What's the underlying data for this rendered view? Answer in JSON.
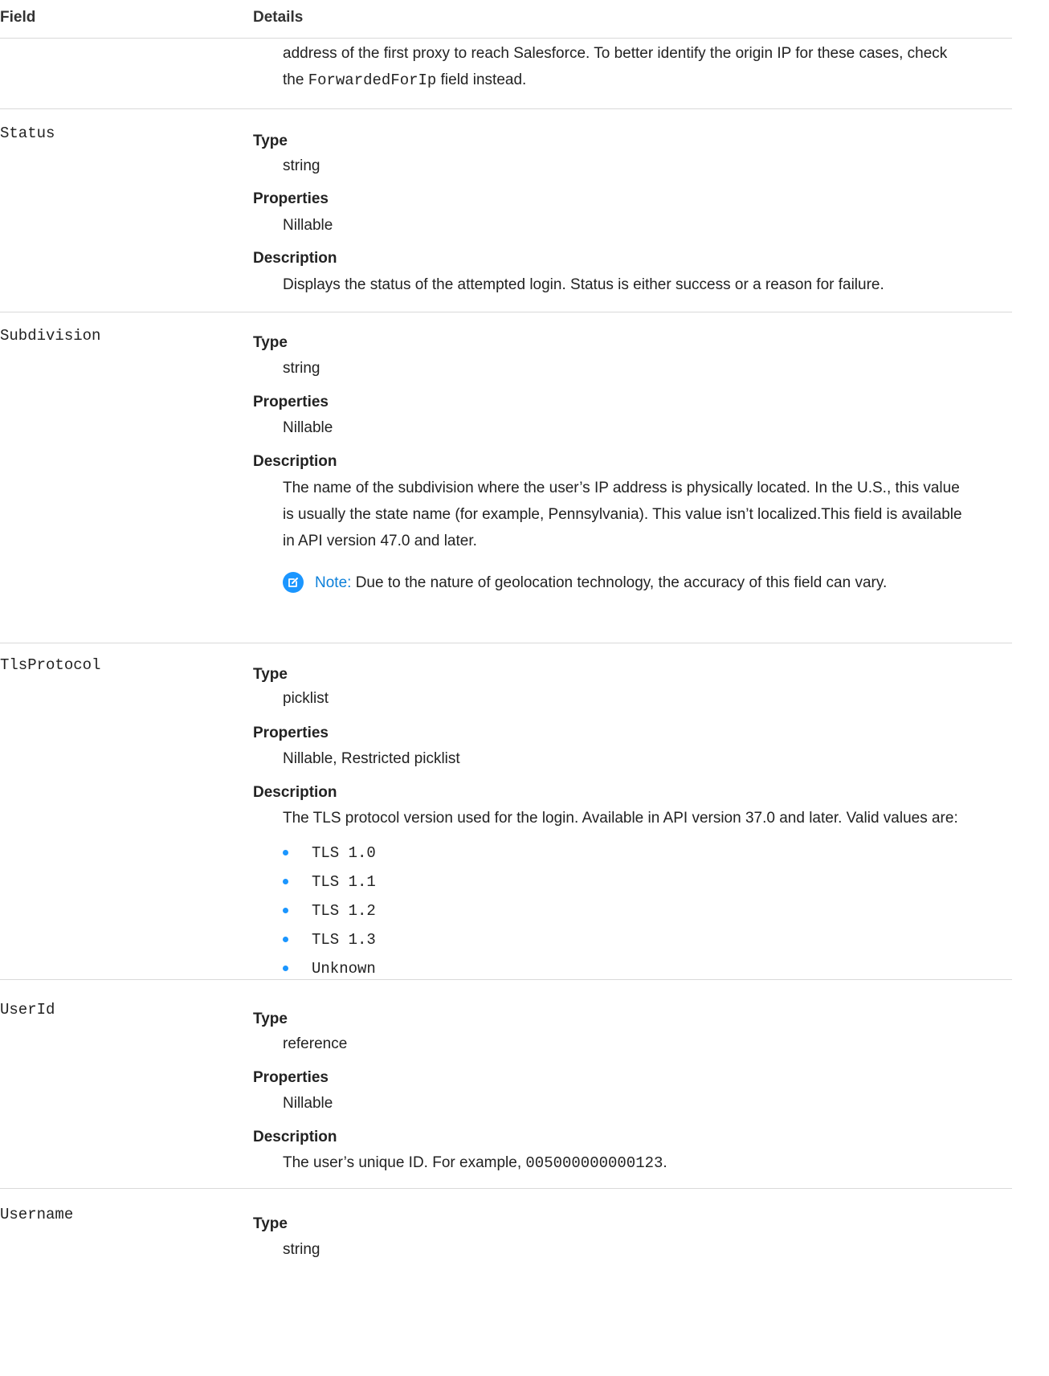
{
  "header": {
    "field": "Field",
    "details": "Details"
  },
  "continuation": {
    "line1": "address of the first proxy to reach Salesforce. To better identify the origin IP for these cases, check",
    "line2_prefix": "the ",
    "line2_code": "ForwardedForIp",
    "line2_suffix": " field instead."
  },
  "labels": {
    "type": "Type",
    "properties": "Properties",
    "description": "Description",
    "note": "Note:"
  },
  "fields": {
    "status": {
      "name": "Status",
      "type": "string",
      "properties": "Nillable",
      "description": "Displays the status of the attempted login. Status is either success or a reason for failure."
    },
    "subdivision": {
      "name": "Subdivision",
      "type": "string",
      "properties": "Nillable",
      "description_l1": "The name of the subdivision where the user’s IP address is physically located. In the U.S., this value",
      "description_l2": "is usually the state name (for example, Pennsylvania). This value isn’t localized.This field is available",
      "description_l3": "in API version 47.0 and later.",
      "note": "Due to the nature of geolocation technology, the accuracy of this field can vary."
    },
    "tlsprotocol": {
      "name": "TlsProtocol",
      "type": "picklist",
      "properties": "Nillable, Restricted picklist",
      "description": "The TLS protocol version used for the login. Available in API version 37.0 and later. Valid values are:",
      "values": [
        "TLS 1.0",
        "TLS 1.1",
        "TLS 1.2",
        "TLS 1.3",
        "Unknown"
      ]
    },
    "userid": {
      "name": "UserId",
      "type": "reference",
      "properties": "Nillable",
      "description_prefix": "The user’s unique ID. For example, ",
      "description_code": "005000000000123",
      "description_suffix": "."
    },
    "username": {
      "name": "Username",
      "type": "string"
    }
  }
}
